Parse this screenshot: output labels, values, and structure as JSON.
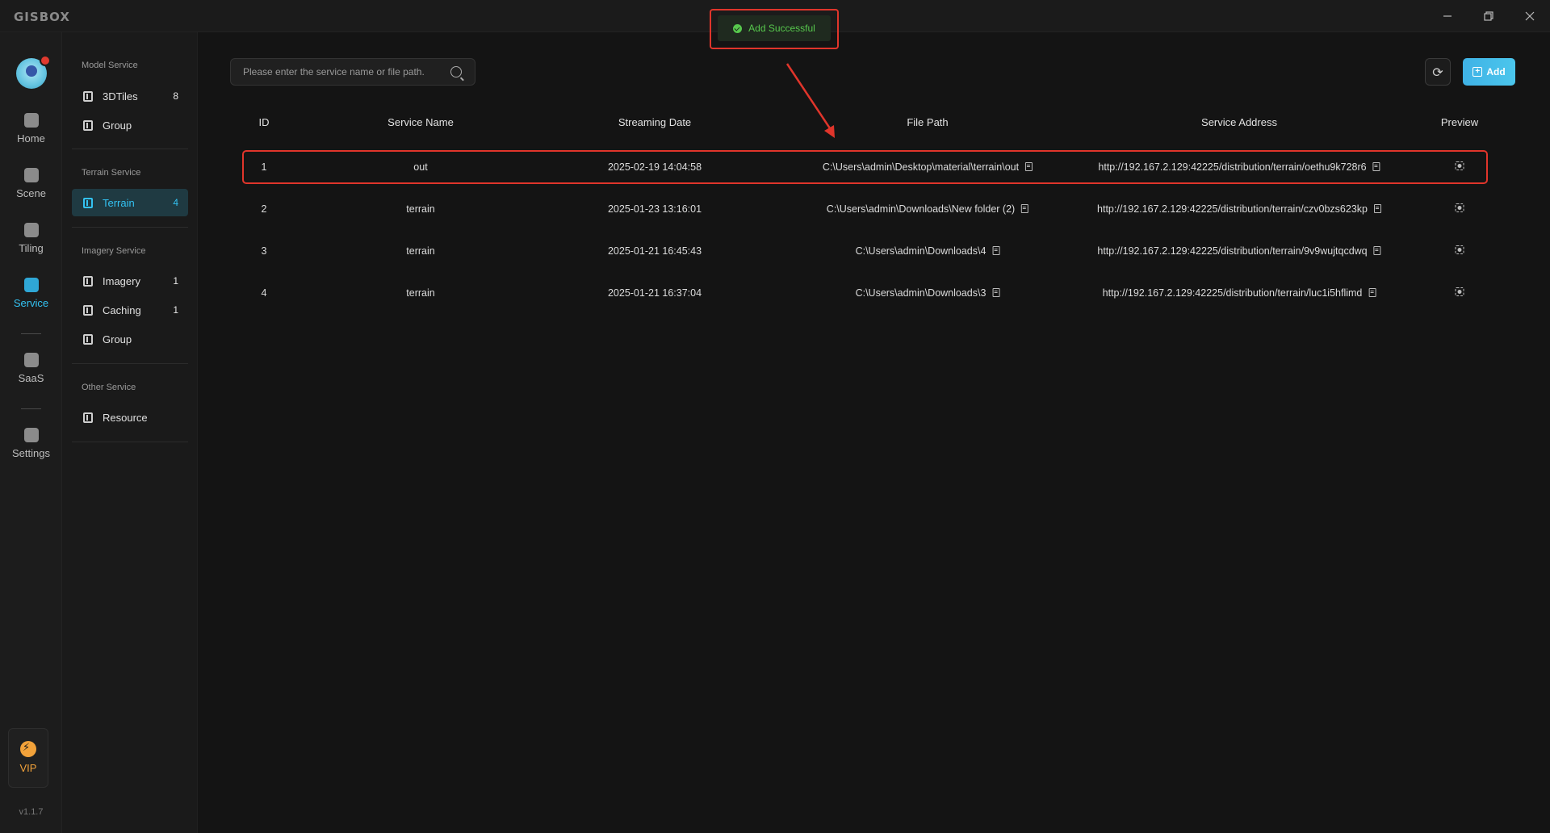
{
  "app": {
    "logo": "GISBOX",
    "version": "v1.1.7"
  },
  "window_controls": {
    "minimize_icon": "minimize-icon",
    "restore_icon": "restore-icon",
    "close_icon": "close-icon"
  },
  "toast": {
    "message": "Add Successful",
    "color": "#57c84d"
  },
  "rail": {
    "items": [
      {
        "label": "Home",
        "icon": "home-icon"
      },
      {
        "label": "Scene",
        "icon": "scene-icon"
      },
      {
        "label": "Tiling",
        "icon": "tiling-icon"
      },
      {
        "label": "Service",
        "icon": "service-icon",
        "active": true
      },
      {
        "label": "SaaS",
        "icon": "saas-icon"
      },
      {
        "label": "Settings",
        "icon": "settings-icon"
      }
    ],
    "vip_label": "VIP"
  },
  "sidebar": {
    "groups": [
      {
        "title": "Model Service",
        "items": [
          {
            "label": "3DTiles",
            "count": "8"
          },
          {
            "label": "Group",
            "count": ""
          }
        ]
      },
      {
        "title": "Terrain Service",
        "items": [
          {
            "label": "Terrain",
            "count": "4",
            "active": true
          }
        ]
      },
      {
        "title": "Imagery Service",
        "items": [
          {
            "label": "Imagery",
            "count": "1"
          },
          {
            "label": "Caching",
            "count": "1"
          },
          {
            "label": "Group",
            "count": ""
          }
        ]
      },
      {
        "title": "Other Service",
        "items": [
          {
            "label": "Resource",
            "count": ""
          }
        ]
      }
    ]
  },
  "toolbar": {
    "search_placeholder": "Please enter the service name or file path.",
    "add_label": "Add",
    "accent": "#3fb2e6"
  },
  "table": {
    "headers": [
      "ID",
      "Service Name",
      "Streaming Date",
      "File Path",
      "Service Address",
      "Preview"
    ],
    "rows": [
      {
        "id": "1",
        "name": "out",
        "date": "2025-02-19 14:04:58",
        "path": "C:\\Users\\admin\\Desktop\\material\\terrain\\out",
        "address": "http://192.167.2.129:42225/distribution/terrain/oethu9k728r6"
      },
      {
        "id": "2",
        "name": "terrain",
        "date": "2025-01-23 13:16:01",
        "path": "C:\\Users\\admin\\Downloads\\New folder (2)",
        "address": "http://192.167.2.129:42225/distribution/terrain/czv0bzs623kp"
      },
      {
        "id": "3",
        "name": "terrain",
        "date": "2025-01-21 16:45:43",
        "path": "C:\\Users\\admin\\Downloads\\4",
        "address": "http://192.167.2.129:42225/distribution/terrain/9v9wujtqcdwq"
      },
      {
        "id": "4",
        "name": "terrain",
        "date": "2025-01-21 16:37:04",
        "path": "C:\\Users\\admin\\Downloads\\3",
        "address": "http://192.167.2.129:42225/distribution/terrain/luc1i5hflimd"
      }
    ]
  },
  "annotation_color": "#e0352b"
}
